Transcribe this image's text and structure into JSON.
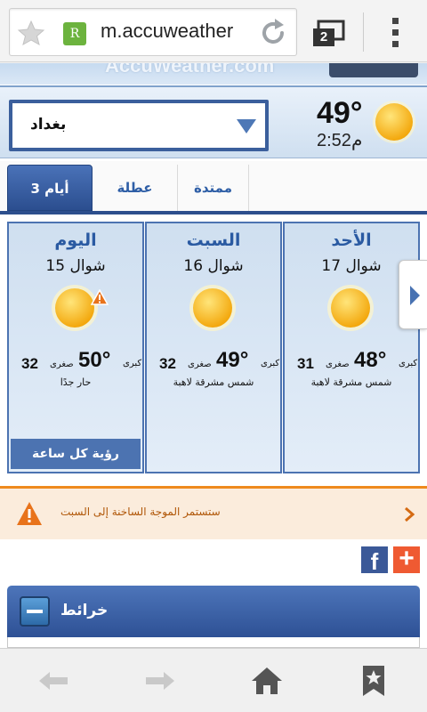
{
  "browser": {
    "url": "m.accuweather",
    "tab_count": "2",
    "favicon_letter": "R"
  },
  "site": {
    "brand": "AccuWeather.com"
  },
  "current": {
    "location": "بغداد",
    "temp": "49°",
    "time": "2:52م"
  },
  "tabs": [
    {
      "label": "3 أيام",
      "active": true
    },
    {
      "label": "عطلة",
      "active": false
    },
    {
      "label": "ممتدة",
      "active": false
    }
  ],
  "days": [
    {
      "name": "اليوم",
      "date": "شوال 15",
      "hi": "50°",
      "hi_label": "كبرى",
      "lo": "32",
      "lo_label": "صغرى",
      "desc": "حار جدًا",
      "warning": true,
      "button": "رؤية كل ساعة"
    },
    {
      "name": "السبت",
      "date": "شوال 16",
      "hi": "49°",
      "hi_label": "كبرى",
      "lo": "32",
      "lo_label": "صغرى",
      "desc": "شمس مشرقة لاهبة"
    },
    {
      "name": "الأحد",
      "date": "شوال 17",
      "hi": "48°",
      "hi_label": "كبرى",
      "lo": "31",
      "lo_label": "صغرى",
      "desc": "شمس مشرقة لاهبة"
    }
  ],
  "alert": {
    "text": "ستستمر الموجة الساخنة إلى السبت",
    "color": "#ef8a1d"
  },
  "maps": {
    "title": "خرائط"
  },
  "social": {
    "fb": "f",
    "plus": "+"
  },
  "icons": {
    "weather": "sun-icon",
    "warning": "warning-triangle-icon",
    "back": "arrow-left-icon",
    "forward": "arrow-right-icon",
    "home": "home-icon",
    "bookmarks": "bookmark-icon"
  },
  "colors": {
    "accent": "#2d4f8d",
    "sun": "#f7b516",
    "link": "#2a5aa2"
  }
}
